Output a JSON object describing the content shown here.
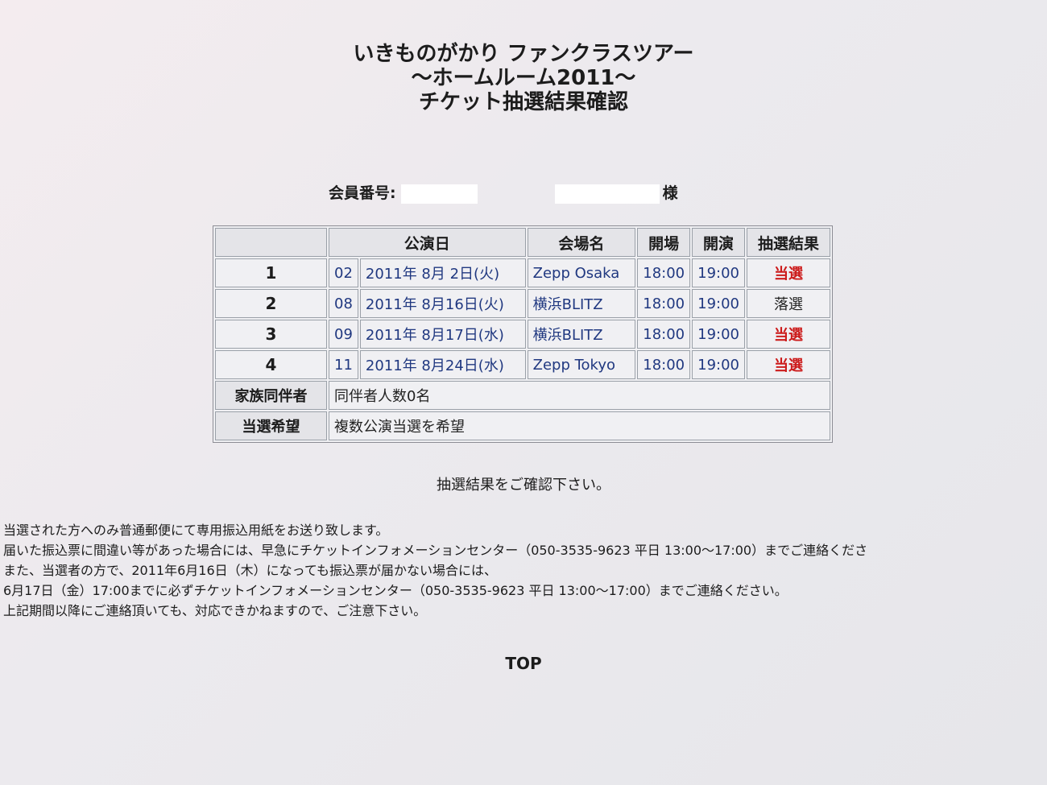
{
  "title": {
    "line1": "いきものがかり ファンクラスツアー",
    "line2": "～ホームルーム2011～",
    "line3": "チケット抽選結果確認"
  },
  "member": {
    "label": "会員番号:",
    "suffix": "様"
  },
  "table": {
    "headers": {
      "date": "公演日",
      "venue": "会場名",
      "open": "開場",
      "start": "開演",
      "result": "抽選結果"
    },
    "rows": [
      {
        "num": "1",
        "code": "02",
        "date": "2011年 8月 2日(火)",
        "venue": "Zepp Osaka",
        "open": "18:00",
        "start": "19:00",
        "result": "当選"
      },
      {
        "num": "2",
        "code": "08",
        "date": "2011年 8月16日(火)",
        "venue": "横浜BLITZ",
        "open": "18:00",
        "start": "19:00",
        "result": "落選"
      },
      {
        "num": "3",
        "code": "09",
        "date": "2011年 8月17日(水)",
        "venue": "横浜BLITZ",
        "open": "18:00",
        "start": "19:00",
        "result": "当選"
      },
      {
        "num": "4",
        "code": "11",
        "date": "2011年 8月24日(水)",
        "venue": "Zepp Tokyo",
        "open": "18:00",
        "start": "19:00",
        "result": "当選"
      }
    ],
    "family_label": "家族同伴者",
    "family_value": "同伴者人数0名",
    "wish_label": "当選希望",
    "wish_value": "複数公演当選を希望"
  },
  "confirm_text": "抽選結果をご確認下さい。",
  "notes": [
    "当選された方へのみ普通郵便にて専用振込用紙をお送り致します。",
    "届いた振込票に間違い等があった場合には、早急にチケットインフォメーションセンター（050-3535-9623 平日 13:00～17:00）までご連絡くださ",
    "また、当選者の方で、2011年6月16日（木）になっても振込票が届かない場合には、",
    " 6月17日（金）17:00までに必ずチケットインフォメーションセンター（050-3535-9623 平日 13:00～17:00）までご連絡ください。",
    "  上記期間以降にご連絡頂いても、対応できかねますので、ご注意下さい。"
  ],
  "top_link": "TOP",
  "colors": {
    "win": "#cc1b1b",
    "text": "#1c1c1c",
    "link": "#203880"
  }
}
